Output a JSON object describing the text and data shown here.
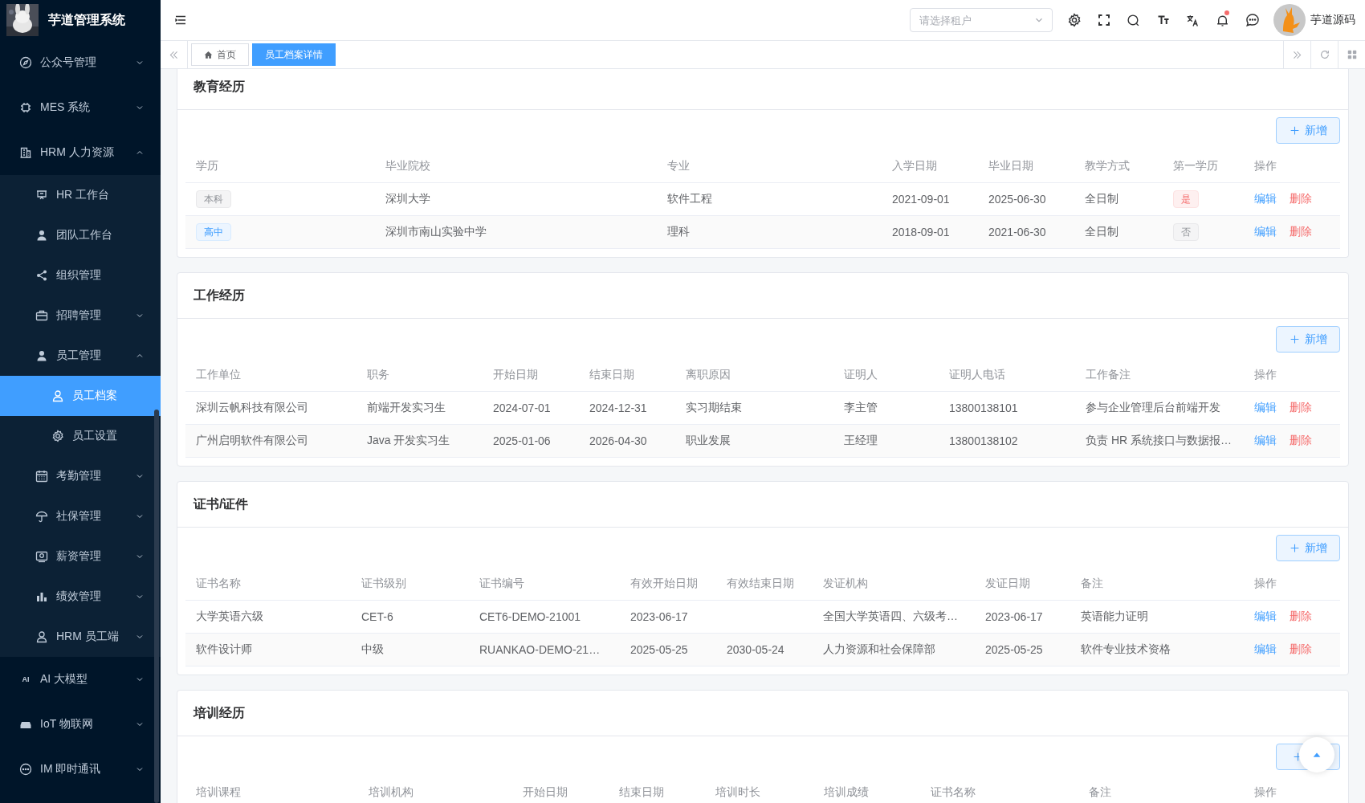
{
  "sidebar": {
    "title": "芋道管理系统",
    "menu": [
      {
        "label": "公众号管理",
        "expanded": false,
        "selected": false
      },
      {
        "label": "MES 系统",
        "expanded": false,
        "selected": false
      },
      {
        "label": "HRM 人力资源",
        "expanded": true,
        "selected": false,
        "children": [
          {
            "label": "HR 工作台",
            "selected": false
          },
          {
            "label": "团队工作台",
            "selected": false
          },
          {
            "label": "组织管理",
            "selected": false
          },
          {
            "label": "招聘管理",
            "expanded": false,
            "selected": false
          },
          {
            "label": "员工管理",
            "expanded": true,
            "selected": false,
            "children": [
              {
                "label": "员工档案",
                "selected": true
              },
              {
                "label": "员工设置",
                "selected": false
              }
            ]
          },
          {
            "label": "考勤管理",
            "expanded": false,
            "selected": false
          },
          {
            "label": "社保管理",
            "expanded": false,
            "selected": false
          },
          {
            "label": "薪资管理",
            "expanded": false,
            "selected": false
          },
          {
            "label": "绩效管理",
            "expanded": false,
            "selected": false
          },
          {
            "label": "HRM 员工端",
            "expanded": false,
            "selected": false
          }
        ]
      },
      {
        "label": "AI 大模型",
        "icon_text": "AI",
        "expanded": false,
        "selected": false
      },
      {
        "label": "IoT 物联网",
        "expanded": false,
        "selected": false
      },
      {
        "label": "IM 即时通讯",
        "expanded": false,
        "selected": false
      }
    ]
  },
  "header": {
    "tenant_select": {
      "placeholder": "请选择租户"
    },
    "notifications": {
      "unread": true
    },
    "user": {
      "name": "芋道源码"
    }
  },
  "tabs": [
    {
      "label": "首页",
      "selected": false
    },
    {
      "label": "员工档案详情",
      "selected": true
    }
  ],
  "sections": [
    {
      "title": "教育经历",
      "add_button": {
        "label": "新增"
      },
      "columns": [
        "学历",
        "毕业院校",
        "专业",
        "入学日期",
        "毕业日期",
        "教学方式",
        "第一学历",
        "操作"
      ],
      "rows": [
        {
          "cells": [
            {
              "tag": "本科",
              "kind": "info"
            },
            "深圳大学",
            "软件工程",
            "2021-09-01",
            "2025-06-30",
            "全日制",
            {
              "tag": "是",
              "kind": "danger"
            }
          ],
          "actions": [
            {
              "label": "编辑",
              "kind": "edit"
            },
            {
              "label": "删除",
              "kind": "delete"
            }
          ]
        },
        {
          "cells": [
            {
              "tag": "高中",
              "kind": "primary"
            },
            "深圳市南山实验中学",
            "理科",
            "2018-09-01",
            "2021-06-30",
            "全日制",
            {
              "tag": "否",
              "kind": "info"
            }
          ],
          "actions": [
            {
              "label": "编辑",
              "kind": "edit"
            },
            {
              "label": "删除",
              "kind": "delete"
            }
          ]
        }
      ]
    },
    {
      "title": "工作经历",
      "add_button": {
        "label": "新增"
      },
      "columns": [
        "工作单位",
        "职务",
        "开始日期",
        "结束日期",
        "离职原因",
        "证明人",
        "证明人电话",
        "工作备注",
        "操作"
      ],
      "rows": [
        {
          "cells": [
            "深圳云帆科技有限公司",
            "前端开发实习生",
            "2024-07-01",
            "2024-12-31",
            "实习期结束",
            "李主管",
            "13800138101",
            "参与企业管理后台前端开发"
          ],
          "actions": [
            {
              "label": "编辑",
              "kind": "edit"
            },
            {
              "label": "删除",
              "kind": "delete"
            }
          ]
        },
        {
          "cells": [
            "广州启明软件有限公司",
            "Java 开发实习生",
            "2025-01-06",
            "2026-04-30",
            "职业发展",
            "王经理",
            "13800138102",
            "负责 HR 系统接口与数据报…"
          ],
          "actions": [
            {
              "label": "编辑",
              "kind": "edit"
            },
            {
              "label": "删除",
              "kind": "delete"
            }
          ]
        }
      ]
    },
    {
      "title": "证书/证件",
      "add_button": {
        "label": "新增"
      },
      "columns": [
        "证书名称",
        "证书级别",
        "证书编号",
        "有效开始日期",
        "有效结束日期",
        "发证机构",
        "发证日期",
        "备注",
        "操作"
      ],
      "rows": [
        {
          "cells": [
            "大学英语六级",
            "CET-6",
            "CET6-DEMO-21001",
            "2023-06-17",
            null,
            "全国大学英语四、六级考…",
            "2023-06-17",
            "英语能力证明"
          ],
          "actions": [
            {
              "label": "编辑",
              "kind": "edit"
            },
            {
              "label": "删除",
              "kind": "delete"
            }
          ]
        },
        {
          "cells": [
            "软件设计师",
            "中级",
            "RUANKAO-DEMO-21…",
            "2025-05-25",
            "2030-05-24",
            "人力资源和社会保障部",
            "2025-05-25",
            "软件专业技术资格"
          ],
          "actions": [
            {
              "label": "编辑",
              "kind": "edit"
            },
            {
              "label": "删除",
              "kind": "delete"
            }
          ]
        }
      ]
    },
    {
      "title": "培训经历",
      "columns": [
        "培训课程",
        "培训机构",
        "开始日期",
        "结束日期",
        "培训时长",
        "培训成绩",
        "证书名称",
        "备注",
        "操作"
      ]
    }
  ]
}
